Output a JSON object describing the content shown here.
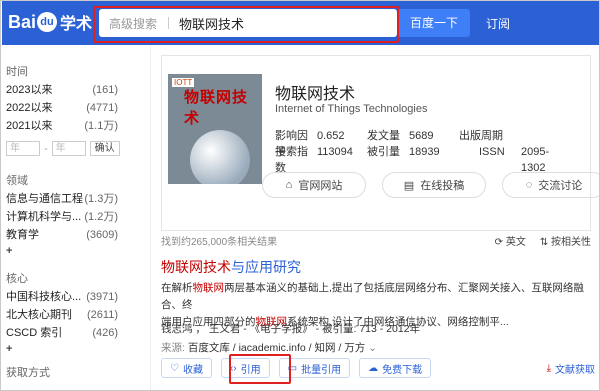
{
  "header": {
    "logo_text": "Bai",
    "logo_paw": "du",
    "logo_suffix": "学术",
    "search_scope": "高级搜索",
    "search_query": "物联网技术",
    "search_button": "百度一下",
    "subscribe": "订阅"
  },
  "sidebar": {
    "time": {
      "title": "时间",
      "items": [
        {
          "label": "2023以来",
          "count": "(161)"
        },
        {
          "label": "2022以来",
          "count": "(4771)"
        },
        {
          "label": "2021以来",
          "count": "(1.1万)"
        }
      ],
      "from_placeholder": "年",
      "to_placeholder": "年",
      "dash": "-",
      "confirm": "确认"
    },
    "field": {
      "title": "领域",
      "items": [
        {
          "label": "信息与通信工程",
          "count": "(1.3万)"
        },
        {
          "label": "计算机科学与...",
          "count": "(1.2万)"
        },
        {
          "label": "教育学",
          "count": "(3609)"
        }
      ],
      "more": "+"
    },
    "core": {
      "title": "核心",
      "items": [
        {
          "label": "中国科技核心...",
          "count": "(3971)"
        },
        {
          "label": "北大核心期刊",
          "count": "(2611)"
        },
        {
          "label": "CSCD 索引",
          "count": "(426)"
        }
      ],
      "more": "+"
    },
    "access": {
      "title": "获取方式"
    }
  },
  "journal": {
    "cover_tag": "IOTT",
    "cover_name": "物联网技术",
    "title": "物联网技术",
    "subtitle": "Internet of Things Technologies",
    "stats": [
      [
        {
          "k": "影响因子",
          "v": "0.652"
        },
        {
          "k": "发文量",
          "v": "5689"
        },
        {
          "k": "出版周期",
          "v": ""
        }
      ],
      [
        {
          "k": "搜索指数",
          "v": "113094"
        },
        {
          "k": "被引量",
          "v": "18939"
        },
        {
          "k": "ISSN",
          "v": "2095-1302"
        }
      ]
    ],
    "buttons": [
      {
        "icon": "home-icon",
        "label": "官网网站"
      },
      {
        "icon": "submit-icon",
        "label": "在线投稿"
      },
      {
        "icon": "chat-icon",
        "label": "交流讨论"
      }
    ]
  },
  "results_meta": {
    "count_text": "找到约265,000条相关结果",
    "lang": "英文",
    "sort": "按相关性"
  },
  "result": {
    "title_hl": "物联网技术",
    "title_rest": "与应用研究",
    "abstract_1a": "在解析",
    "abstract_1hl": "物联网",
    "abstract_1b": "两层基本涵义的基础上,提出了包括底层网络分布、汇聚网关接入、互联网络融合、终",
    "abstract_2a": "端用户应用四部分的",
    "abstract_2hl": "物联网",
    "abstract_2b": "系统架构,设计了由网络通信协议、网络控制平...",
    "authors": "钱志鸿 ， 王义君 - 《电子学报》 - 被引量: 713 - 2012年",
    "source_label": "来源:",
    "source": "百度文库 / iacademic.info / 知网 / 万方",
    "actions": [
      {
        "icon": "heart-icon",
        "label": "收藏"
      },
      {
        "icon": "code-icon",
        "label": "引用"
      },
      {
        "icon": "folder-icon",
        "label": "批量引用"
      },
      {
        "icon": "cloud-icon",
        "label": "免费下载"
      }
    ],
    "doc_get": "文献获取"
  }
}
